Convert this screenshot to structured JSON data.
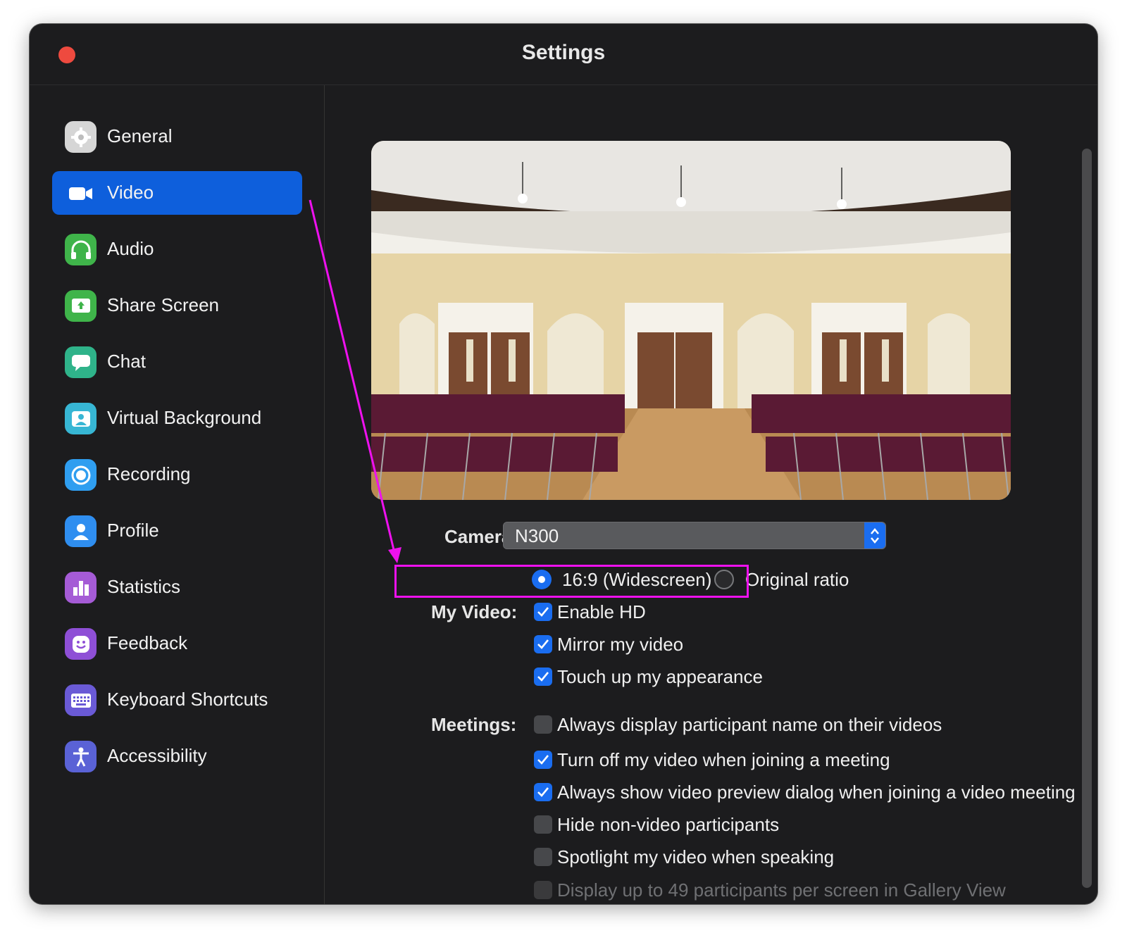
{
  "window": {
    "title": "Settings"
  },
  "sidebar": {
    "items": [
      {
        "label": "General",
        "icon": "gear-icon",
        "color": "#d8d8d8",
        "active": false
      },
      {
        "label": "Video",
        "icon": "video-camera-icon",
        "color": "#0e5fdc",
        "active": true
      },
      {
        "label": "Audio",
        "icon": "headphones-icon",
        "color": "#3fb44a",
        "active": false
      },
      {
        "label": "Share Screen",
        "icon": "share-screen-icon",
        "color": "#3fb44a",
        "active": false
      },
      {
        "label": "Chat",
        "icon": "chat-bubble-icon",
        "color": "#2fb38a",
        "active": false
      },
      {
        "label": "Virtual Background",
        "icon": "virtual-background-icon",
        "color": "#37b6d4",
        "active": false
      },
      {
        "label": "Recording",
        "icon": "record-icon",
        "color": "#2f9ef0",
        "active": false
      },
      {
        "label": "Profile",
        "icon": "person-icon",
        "color": "#2f8ef0",
        "active": false
      },
      {
        "label": "Statistics",
        "icon": "bar-chart-icon",
        "color": "#a55bd6",
        "active": false
      },
      {
        "label": "Feedback",
        "icon": "smiley-icon",
        "color": "#8e4fd6",
        "active": false
      },
      {
        "label": "Keyboard Shortcuts",
        "icon": "keyboard-icon",
        "color": "#6a5ad6",
        "active": false
      },
      {
        "label": "Accessibility",
        "icon": "accessibility-icon",
        "color": "#5a62d6",
        "active": false
      }
    ]
  },
  "video": {
    "camera_label": "Camera:",
    "camera_value": "N300",
    "ratio_options": [
      {
        "label": "16:9 (Widescreen)",
        "selected": true
      },
      {
        "label": "Original ratio",
        "selected": false
      }
    ],
    "my_video_label": "My Video:",
    "my_video_options": [
      {
        "label": "Enable HD",
        "checked": true
      },
      {
        "label": "Mirror my video",
        "checked": true
      },
      {
        "label": "Touch up my appearance",
        "checked": true
      }
    ],
    "meetings_label": "Meetings:",
    "meetings_options": [
      {
        "label": "Always display participant name on their videos",
        "checked": false
      },
      {
        "label": "Turn off my video when joining a meeting",
        "checked": true
      },
      {
        "label": "Always show video preview dialog when joining a video meeting",
        "checked": true
      },
      {
        "label": "Hide non-video participants",
        "checked": false
      },
      {
        "label": "Spotlight my video when speaking",
        "checked": false
      },
      {
        "label": "Display up to 49 participants per screen in Gallery View",
        "checked": false,
        "disabled": true
      }
    ]
  },
  "colors": {
    "accent": "#1a6df0",
    "annotation": "#ee11ee",
    "window_bg": "#1c1c1e"
  }
}
